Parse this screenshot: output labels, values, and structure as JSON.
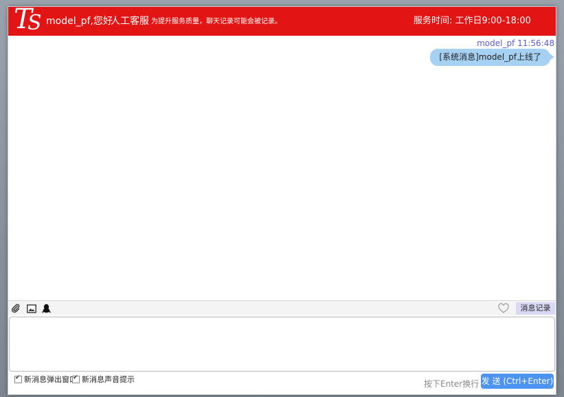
{
  "header": {
    "logo_text_t": "T",
    "logo_text_s": "S",
    "greeting": "model_pf,您好",
    "service": "人工客服",
    "note": "为提升服务质量，聊天记录可能会被记录。",
    "hours": "服务时间: 工作日9:00-18:00",
    "bg_color": "#e31414"
  },
  "messages": [
    {
      "sender": "model_pf",
      "time": "11:56:48",
      "meta": "model_pf 11:56:48",
      "text": "[系统消息]model_pf上线了"
    }
  ],
  "toolbar": {
    "icons": [
      "attachment-icon",
      "image-icon",
      "qq-icon"
    ],
    "favorite_icon": "heart-icon",
    "history_label": "消息记录"
  },
  "input": {
    "value": "",
    "placeholder": ""
  },
  "footer": {
    "popup_label": "新消息弹出窗口",
    "popup_checked": true,
    "sound_label": "新消息声音提示",
    "sound_checked": true,
    "enter_hint": "按下Enter换行",
    "send_label": "发 送 (Ctrl+Enter)",
    "send_color": "#4d94f0"
  }
}
